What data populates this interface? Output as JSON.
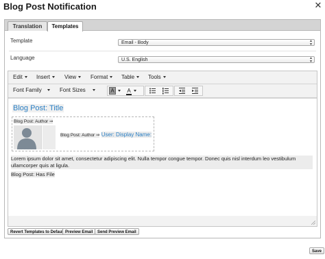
{
  "dialog": {
    "title": "Blog Post Notification"
  },
  "tabs": [
    {
      "label": "Translation",
      "active": false
    },
    {
      "label": "Templates",
      "active": true
    }
  ],
  "form": {
    "template_label": "Template",
    "template_value": "Email - Body",
    "language_label": "Language",
    "language_value": "U.S. English"
  },
  "editor": {
    "menus": [
      "Edit",
      "Insert",
      "View",
      "Format",
      "Table",
      "Tools"
    ],
    "toolbar": {
      "font_family": "Font Family",
      "font_sizes": "Font Sizes",
      "text_color_letter": "A",
      "bg_color_letter": "A"
    },
    "content": {
      "heading": "Blog Post: Title",
      "author_1": "Blog Post: Author ⇒",
      "author_2": "Blog Post: Author ⇒",
      "display_name": "User: Display Name:",
      "body": "Lorem ipsum dolor sit amet, consectetur adipiscing elit. Nulla tempor congue tempor. Donec quis nisl interdum leo vestibulum ullamcorper quis at ligula.",
      "has_file": "Blog Post: Has File"
    }
  },
  "buttons": {
    "revert": "Revert Templates to Default",
    "preview": "Preview Email",
    "send_preview": "Send Preview Email",
    "save": "Save"
  },
  "icons": [
    "close-icon",
    "text-color-icon",
    "background-color-icon",
    "bullet-list-icon",
    "numbered-list-icon",
    "outdent-icon",
    "indent-icon",
    "default-avatar-icon",
    "resize-handle-icon"
  ],
  "colors": {
    "link_blue": "#2a7fc4",
    "tab_strip": "#d4d4d4"
  }
}
